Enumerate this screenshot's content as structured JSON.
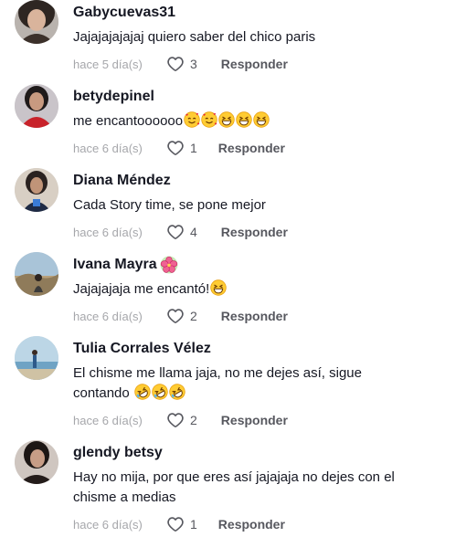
{
  "comments": [
    {
      "username": "Gabycuevas31",
      "text": "Jajajajajajaj quiero saber del chico paris",
      "date": "hace 5 día(s)",
      "likes": "3",
      "reply": "Responder",
      "avatar": "dark-haired woman"
    },
    {
      "username": "betydepinel",
      "text": "me encantoooooo",
      "emojis": [
        "smiling-face-with-hearts",
        "smiling-face-with-hearts",
        "grinning-squinting-face",
        "grinning-squinting-face",
        "grinning-squinting-face"
      ],
      "date": "hace 6 día(s)",
      "likes": "1",
      "reply": "Responder",
      "avatar": "woman in red"
    },
    {
      "username": "Diana Méndez",
      "text": "Cada Story time, se pone mejor",
      "date": "hace 6 día(s)",
      "likes": "4",
      "reply": "Responder",
      "avatar": "woman in dark outfit"
    },
    {
      "username": "Ivana Mayra",
      "name_emoji": "hibiscus",
      "text": "Jajajajaja me encantó!",
      "emojis": [
        "grinning-squinting-face"
      ],
      "date": "hace 6 día(s)",
      "likes": "2",
      "reply": "Responder",
      "avatar": "landscape with person"
    },
    {
      "username": "Tulia Corrales Vélez",
      "text_line1": "El chisme me llama jaja, no me dejes así, sigue",
      "text_line2": "contando",
      "emojis": [
        "rolling-on-floor-laughing",
        "rolling-on-floor-laughing",
        "rolling-on-floor-laughing"
      ],
      "date": "hace 6 día(s)",
      "likes": "2",
      "reply": "Responder",
      "avatar": "person by the sea"
    },
    {
      "username": "glendy betsy",
      "text_line1": "Hay no mija, por que eres así jajajaja no dejes con el",
      "text_line2": "chisme a medias",
      "date": "hace 6 día(s)",
      "likes": "1",
      "reply": "Responder",
      "avatar": "dark-haired woman"
    }
  ],
  "colors": {
    "text": "#161823",
    "muted": "#a6a7ab",
    "action": "#57585f"
  }
}
